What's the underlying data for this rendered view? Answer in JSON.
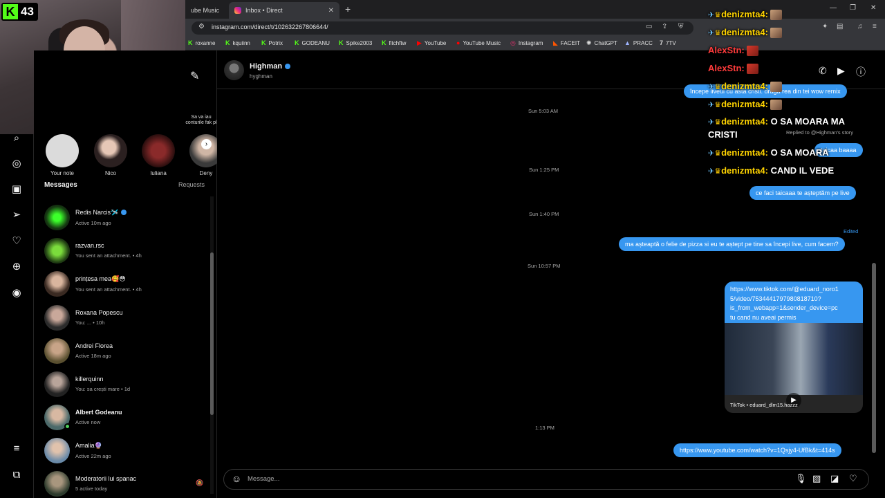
{
  "browser": {
    "tabs": [
      {
        "label": "ube Music"
      },
      {
        "label": "Inbox • Direct"
      }
    ],
    "url": "instagram.com/direct/t/102632267806644/",
    "bookmarks": [
      "roxanne",
      "kquiinn",
      "Potrix",
      "GODEANU",
      "Spike2003",
      "fitchftw",
      "YouTube",
      "YouTube Music",
      "Instagram",
      "FACEIT",
      "ChatGPT",
      "PRACC",
      "7TV"
    ]
  },
  "webcam": {
    "badge_count": "43"
  },
  "inbox": {
    "note_tip": "Sa va iau conturile fak pl",
    "stories": [
      {
        "label": "Your note"
      },
      {
        "label": "Nico"
      },
      {
        "label": "Iuliana"
      },
      {
        "label": "Deny"
      }
    ],
    "messages_heading": "Messages",
    "requests_heading": "Requests",
    "conversations": [
      {
        "name": "Redis Narcis🛩️",
        "sub": "Active 10m ago"
      },
      {
        "name": "razvan.rsc",
        "sub": "You sent an attachment. • 4h"
      },
      {
        "name": "prințesa mea🥰😳",
        "sub": "You sent an attachment. • 4h"
      },
      {
        "name": "Roxana Popescu",
        "sub": "You: ... • 10h"
      },
      {
        "name": "Andrei Florea",
        "sub": "Active 18m ago"
      },
      {
        "name": "killerquinn",
        "sub": "You: sa crești mare • 1d"
      },
      {
        "name": "Albert Godeanu",
        "sub": "Active now"
      },
      {
        "name": "Amalia🔮",
        "sub": "Active 22m ago"
      },
      {
        "name": "Moderatorii lui spanac",
        "sub": "5 active today"
      }
    ]
  },
  "chat": {
    "peer_name": "Highman",
    "peer_handle": "hyghman",
    "stamps": [
      "Sun 5:03 AM",
      "Sun 1:25 PM",
      "Sun 1:40 PM",
      "Sun 10:57 PM",
      "1:13 PM"
    ],
    "bubbles": {
      "top": "începe liveul cu asta cristi. dragă rea din tei wow remix",
      "reply_label": "Replied to @Highman's story",
      "reply": "taicaa baaaa",
      "live": "ce faci taicaaa te așteptăm pe live",
      "edited_label": "Edited",
      "pizza": "ma așteaptă o felie de pizza si eu te aștept pe tine sa începi live, cum facem?",
      "youtube": "https://www.youtube.com/watch?v=1Qsjy4-UfBk&t=414s"
    },
    "tiktok_card": {
      "line1": "https://www.tiktok.com/@eduard_noro1",
      "line2": "5/video/7534441797980818710?",
      "line3": "is_from_webapp=1&sender_device=pc",
      "line4": "tu cand nu aveai permis",
      "source": "TikTok • eduard_dlm15.hazzz"
    },
    "composer_placeholder": "Message..."
  },
  "stream_chat": [
    {
      "user": "denizmta4:",
      "text": ""
    },
    {
      "user": "denizmta4:",
      "text": ""
    },
    {
      "user": "AlexStn:",
      "text": ""
    },
    {
      "user": "AlexStn:",
      "text": ""
    },
    {
      "user": "denizmta4:",
      "text": ""
    },
    {
      "user": "denizmta4:",
      "text": ""
    },
    {
      "user": "denizmta4:",
      "text": "O SA MOARA MA"
    },
    {
      "user": "",
      "text": "CRISTI"
    },
    {
      "user": "denizmta4:",
      "text": "O SA MOARA"
    },
    {
      "user": "denizmta4:",
      "text": "CAND IL VEDE"
    }
  ],
  "colors": {
    "accent_blue": "#3797f0",
    "kick_green": "#53fc18",
    "chat_yellow": "#ffd400",
    "chat_red": "#ff3b3b"
  }
}
